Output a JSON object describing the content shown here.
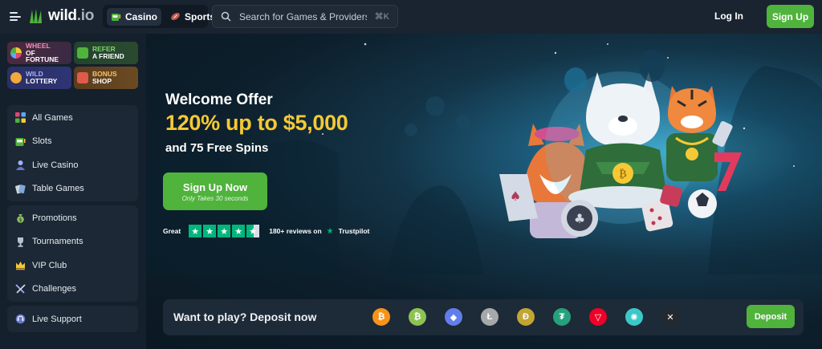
{
  "header": {
    "logo_text": "wild",
    "logo_suffix": ".io",
    "tabs": [
      {
        "label": "Casino",
        "icon": "slot-machine-icon",
        "active": true
      },
      {
        "label": "Sports",
        "icon": "football-icon",
        "active": false
      }
    ],
    "search": {
      "placeholder": "Search for Games & Providers",
      "shortcut": "⌘K"
    },
    "login_label": "Log In",
    "signup_label": "Sign Up"
  },
  "sidebar": {
    "promos": [
      {
        "line1": "Wheel",
        "line2": "of Fortune",
        "icon": "wheel-icon"
      },
      {
        "line1": "Refer",
        "line2": "a Friend",
        "icon": "refer-icon"
      },
      {
        "line1": "Wild",
        "line2": "Lottery",
        "icon": "lottery-icon"
      },
      {
        "line1": "Bonus",
        "line2": "Shop",
        "icon": "shop-icon"
      }
    ],
    "games": [
      {
        "label": "All Games",
        "icon": "grid-icon"
      },
      {
        "label": "Slots",
        "icon": "slot-machine-icon"
      },
      {
        "label": "Live Casino",
        "icon": "live-dealer-icon"
      },
      {
        "label": "Table Games",
        "icon": "cards-icon"
      }
    ],
    "more": [
      {
        "label": "Promotions",
        "icon": "money-bag-icon"
      },
      {
        "label": "Tournaments",
        "icon": "trophy-icon"
      },
      {
        "label": "VIP Club",
        "icon": "crown-icon"
      },
      {
        "label": "Challenges",
        "icon": "swords-icon"
      }
    ],
    "support": {
      "label": "Live Support",
      "icon": "support-icon"
    }
  },
  "hero": {
    "welcome": "Welcome Offer",
    "offer": "120% up to $5,000",
    "spins": "and 75 Free Spins",
    "cta_label": "Sign Up Now",
    "cta_sub": "Only Takes 30 seconds",
    "rating_word": "Great",
    "rating_stars": 4.5,
    "reviews": "180+ reviews on",
    "trustpilot": "Trustpilot"
  },
  "deposit": {
    "text": "Want to play? Deposit now",
    "button": "Deposit",
    "coins": [
      {
        "name": "bitcoin",
        "glyph": "₿",
        "color": "#f7931a"
      },
      {
        "name": "bitcoin-cash",
        "glyph": "₿",
        "color": "#8dc351"
      },
      {
        "name": "ethereum",
        "glyph": "◆",
        "color": "#627eea"
      },
      {
        "name": "litecoin",
        "glyph": "Ł",
        "color": "#a6a9aa"
      },
      {
        "name": "dogecoin",
        "glyph": "Ð",
        "color": "#c2a633"
      },
      {
        "name": "tether",
        "glyph": "₮",
        "color": "#26a17b"
      },
      {
        "name": "tron",
        "glyph": "▽",
        "color": "#ef0027"
      },
      {
        "name": "cardano",
        "glyph": "✺",
        "color": "#3cc8c8"
      },
      {
        "name": "ripple",
        "glyph": "✕",
        "color": "#23292f"
      }
    ]
  }
}
